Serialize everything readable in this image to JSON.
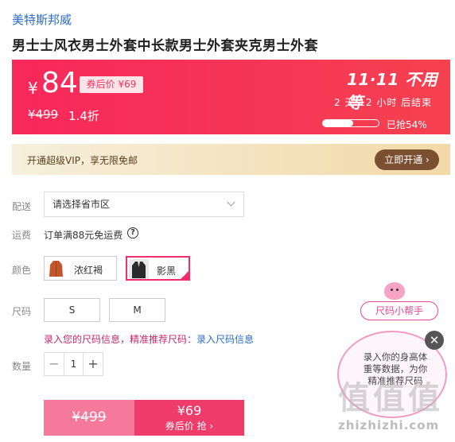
{
  "brand": "美特斯邦威",
  "product_title": "男士士风衣男士外套中长款男士外套夹克男士外套",
  "price_banner": {
    "currency": "¥",
    "price": "84",
    "coupon_label": "券后价 ¥69",
    "original_price": "¥499",
    "discount": "1.4折",
    "promo_logo": "11·11 不用等",
    "countdown": "2 天 12 小时 后结束",
    "sold_percent": 0.54,
    "sold_label": "已抢54%"
  },
  "vip": {
    "text": "开通超级VIP，享无限免邮",
    "button_label": "立即开通 ›"
  },
  "delivery": {
    "label": "配送",
    "placeholder": "请选择省市区"
  },
  "shipping": {
    "label": "运费",
    "text": "订单满88元免运费",
    "help_icon": "?"
  },
  "color": {
    "label": "颜色",
    "options": [
      {
        "name": "浓红褐",
        "selected": false,
        "swatch": "#c4562e"
      },
      {
        "name": "影黑",
        "selected": true,
        "swatch": "#2a2a2a"
      }
    ]
  },
  "size": {
    "label": "尺码",
    "options": [
      "S",
      "M"
    ],
    "hint": "录入您的尺码信息，精准推荐尺码：",
    "hint_link": "录入尺码信息"
  },
  "quantity": {
    "label": "数量",
    "value": "1",
    "minus": "−",
    "plus": "+"
  },
  "buy": {
    "original_price": "¥499",
    "coupon_price": "¥69",
    "action_label": "券后价 抢 ›"
  },
  "size_helper": {
    "tag": "尺码小帮手",
    "text": "录入你的身高体重等数据，为你精准推荐尺码",
    "close": "✕"
  },
  "watermark": {
    "glyph": "值值值",
    "domain": "zhizhizhi.com"
  },
  "colors": {
    "accent": "#f02e6b",
    "banner": "#f8285a",
    "link": "#2b6cc4",
    "vip_button": "#7a5030"
  }
}
